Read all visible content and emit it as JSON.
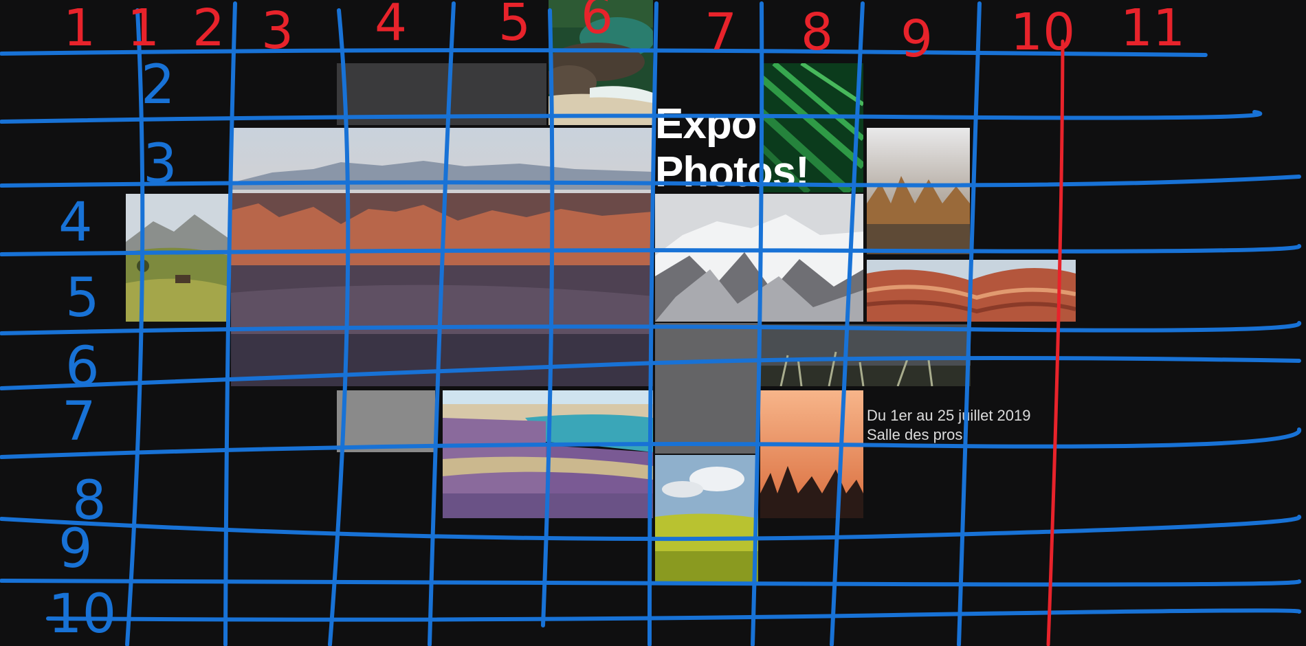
{
  "exhibition": {
    "title_line1": "Expo",
    "title_line2": "Photos!",
    "date_line": "Du 1er au 25 juillet 2019",
    "venue_line": "Salle des pros"
  },
  "column_marks": [
    "1",
    "1",
    "2",
    "3",
    "4",
    "5",
    "6",
    "7",
    "8",
    "9",
    "10",
    "11"
  ],
  "row_marks": [
    "2",
    "3",
    "4",
    "5",
    "6",
    "7",
    "8",
    "9",
    "10"
  ],
  "colors": {
    "background": "#0f0f10",
    "row_lines": "#1872d6",
    "column_lines": "#e8232b",
    "placeholder_dark": "#3a3a3c",
    "placeholder_mid": "#646466",
    "placeholder_light": "#8a8a8a"
  }
}
